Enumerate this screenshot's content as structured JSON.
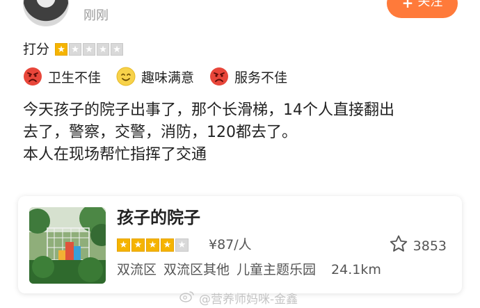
{
  "header": {
    "time": "刚刚",
    "follow_plus": "+",
    "follow_label": "关注"
  },
  "rating": {
    "label": "打分",
    "value": 1,
    "max": 5,
    "star_color": "#f5b400"
  },
  "tags": [
    {
      "text": "卫生不佳",
      "icon": "angry-face-icon",
      "color": "#e8463a"
    },
    {
      "text": "趣味满意",
      "icon": "smile-face-icon",
      "color": "#f7d24a"
    },
    {
      "text": "服务不佳",
      "icon": "angry-face-icon",
      "color": "#e8463a"
    }
  ],
  "review": {
    "line1": "今天孩子的院子出事了，那个长滑梯，14个人直接翻出",
    "line2": "去了，警察，交警，消防，120都去了。",
    "line3": "本人在现场帮忙指挥了交通"
  },
  "shop": {
    "name": "孩子的院子",
    "stars": 4,
    "max_stars": 5,
    "price": "¥87/人",
    "favorites": "3853",
    "district": "双流区",
    "subdistrict": "双流区其他",
    "category": "儿童主题乐园",
    "distance": "24.1km"
  },
  "watermark": {
    "text": "@营养师妈咪-金鑫"
  },
  "colors": {
    "accent": "#ff7a3a",
    "star": "#f5b400",
    "muted_text": "#9a9a9a"
  }
}
